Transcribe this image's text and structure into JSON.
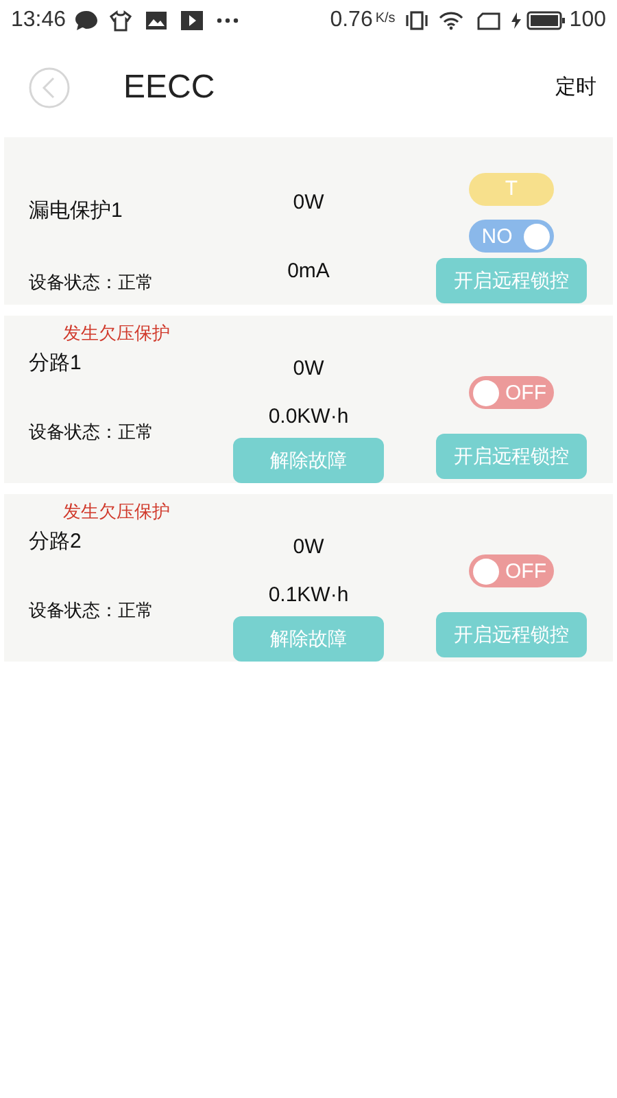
{
  "status_bar": {
    "time": "13:46",
    "speed": "0.76",
    "speed_unit": "K/s",
    "battery": "100"
  },
  "header": {
    "title": "EECC",
    "action": "定时"
  },
  "cards": [
    {
      "name": "漏电保护1",
      "status": "设备状态：正常",
      "power": "0W",
      "reading": "0mA",
      "badge": "T",
      "toggle": {
        "label": "NO",
        "on": true
      },
      "lock_button": "开启远程锁控"
    },
    {
      "alert": "发生欠压保护",
      "name": "分路1",
      "status": "设备状态：正常",
      "power": "0W",
      "reading": "0.0KW·h",
      "toggle": {
        "label": "OFF",
        "on": false
      },
      "clear_button": "解除故障",
      "lock_button": "开启远程锁控"
    },
    {
      "alert": "发生欠压保护",
      "name": "分路2",
      "status": "设备状态：正常",
      "power": "0W",
      "reading": "0.1KW·h",
      "toggle": {
        "label": "OFF",
        "on": false
      },
      "clear_button": "解除故障",
      "lock_button": "开启远程锁控"
    }
  ]
}
